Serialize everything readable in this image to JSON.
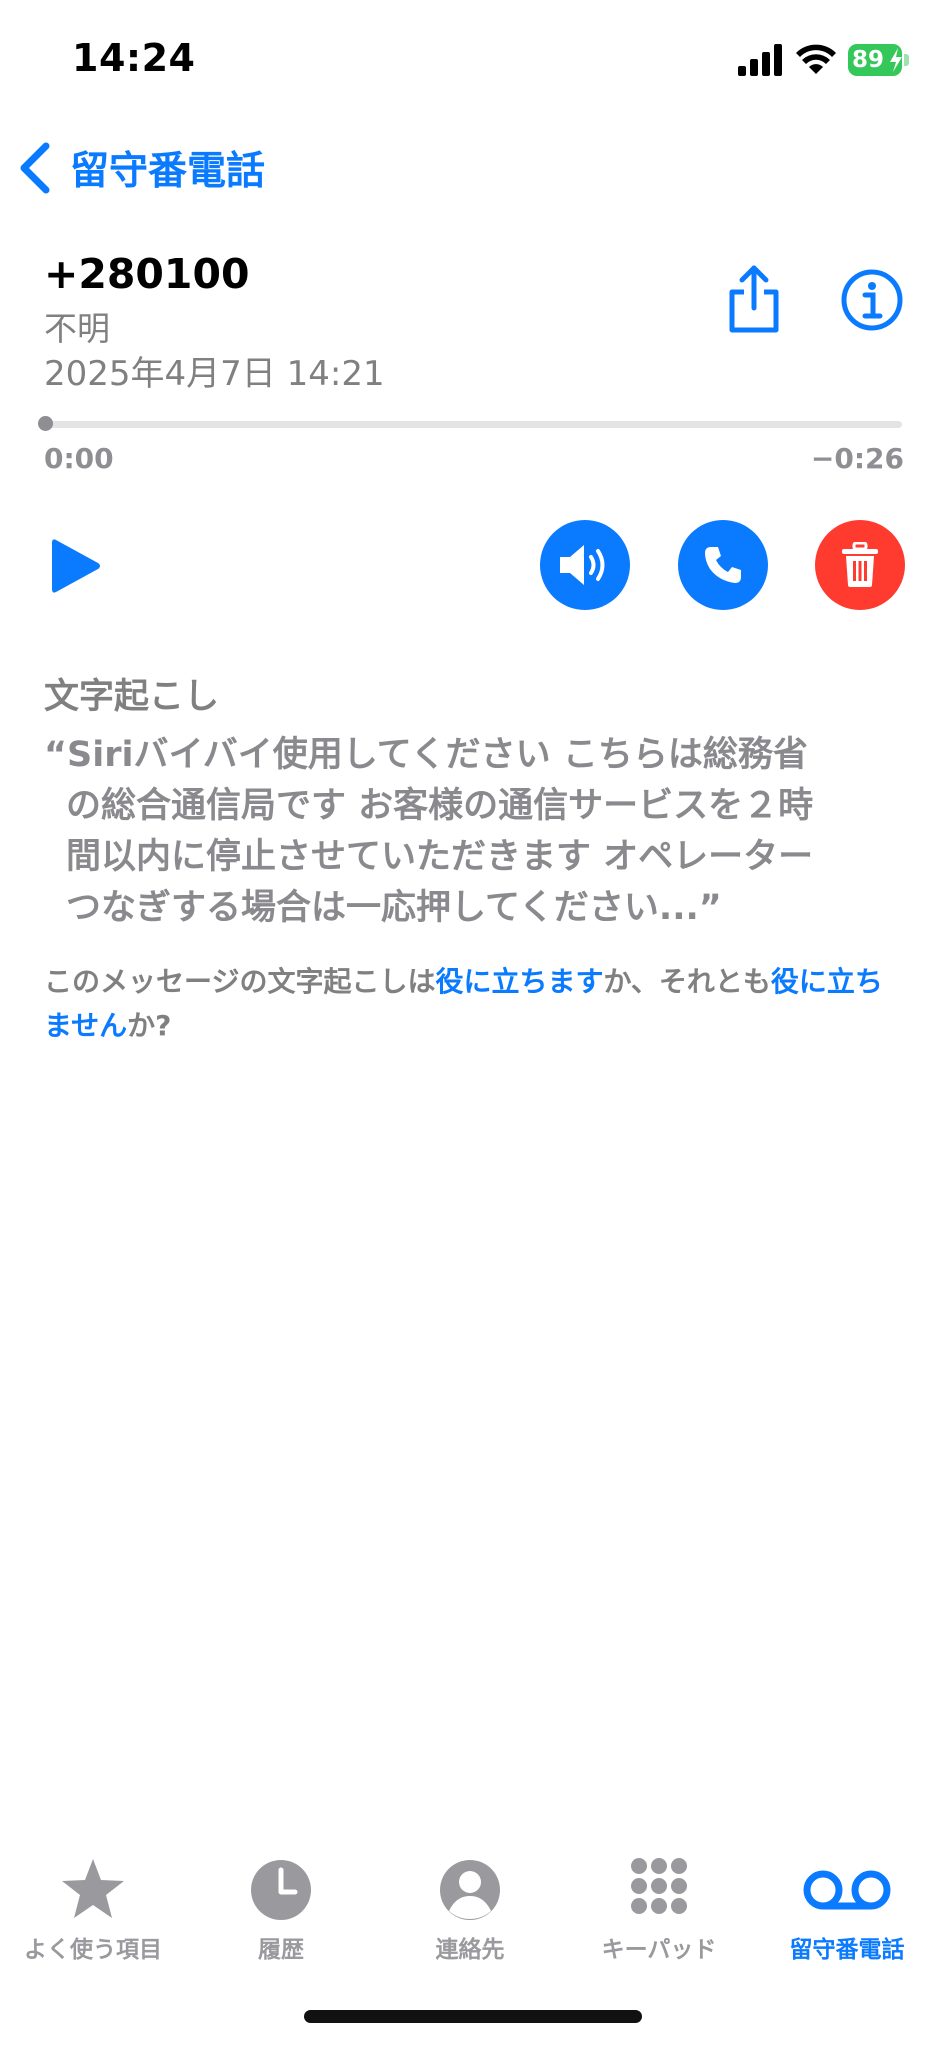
{
  "status_bar": {
    "time": "14:24",
    "battery": "89"
  },
  "nav": {
    "back_label": "留守番電話"
  },
  "voicemail": {
    "number": "+280100",
    "caller_label": "不明",
    "datetime": "2025年4月7日 14:21",
    "elapsed": "0:00",
    "remaining": "−0:26",
    "progress": 0
  },
  "transcript": {
    "title": "文字起こし",
    "text": "“Siriバイバイ使用してください こちらは総務省\nの総合通信局です お客様の通信サービスを２時\n間以内に停止させていただきます オペレーター\nつなぎする場合は一応押してください...”"
  },
  "feedback": {
    "prefix": "このメッセージの文字起こしは",
    "helpful": "役に立ちます",
    "middle": "か、それとも",
    "not_helpful": "役に立ちません",
    "suffix": "か?"
  },
  "tabs": [
    {
      "label": "よく使う項目",
      "icon": "star-icon"
    },
    {
      "label": "履歴",
      "icon": "clock-icon"
    },
    {
      "label": "連絡先",
      "icon": "person-icon"
    },
    {
      "label": "キーパッド",
      "icon": "keypad-icon"
    },
    {
      "label": "留守番電話",
      "icon": "voicemail-icon",
      "active": true
    }
  ],
  "colors": {
    "accent": "#0a7aff",
    "delete": "#ff3b30",
    "battery": "#34c759"
  }
}
